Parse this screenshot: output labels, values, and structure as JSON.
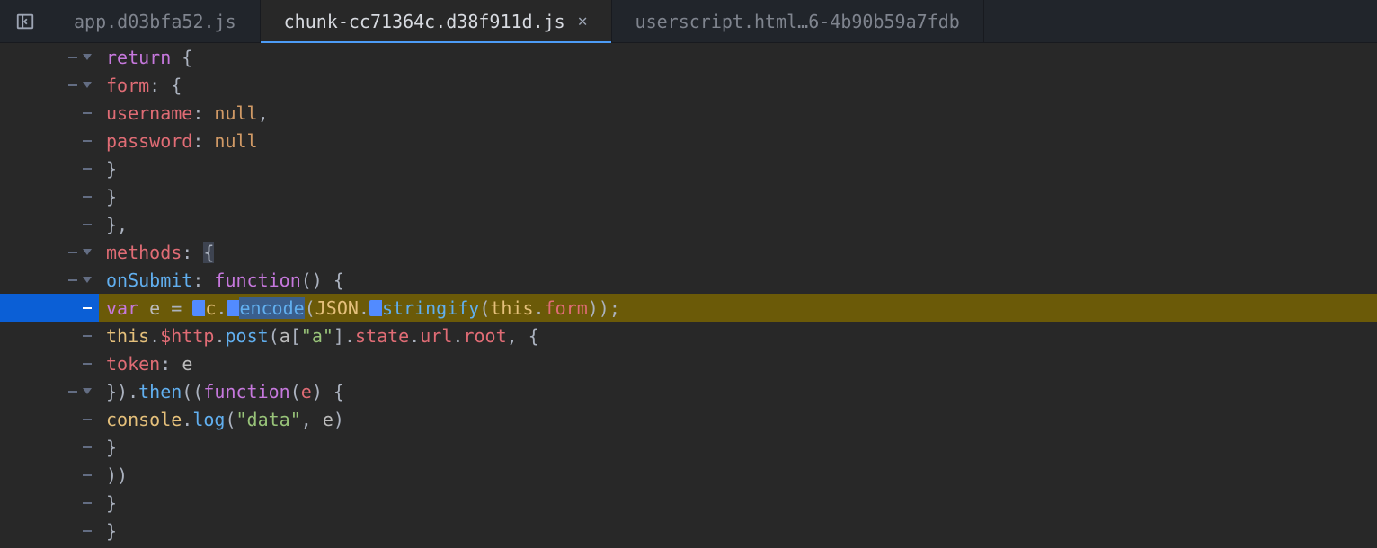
{
  "tabs": {
    "t0": "app.d03bfa52.js",
    "t1": "chunk-cc71364c.d38f911d.js",
    "t2": "userscript.html…6-4b90b59a7fdb"
  },
  "tok": {
    "return": "return",
    "methods": "methods",
    "onSubmit": "onSubmit",
    "function": "function",
    "form": "form",
    "username": "username",
    "password": "password",
    "null": "null",
    "var": "var",
    "e": "e",
    "c": "c",
    "encode": "encode",
    "JSON": "JSON",
    "stringify": "stringify",
    "this": "this",
    "http": "$http",
    "post": "post",
    "a": "a",
    "aStr": "\"a\"",
    "state": "state",
    "url": "url",
    "root": "root",
    "token": "token",
    "then": "then",
    "console": "console",
    "log": "log",
    "dataStr": "\"data\""
  }
}
